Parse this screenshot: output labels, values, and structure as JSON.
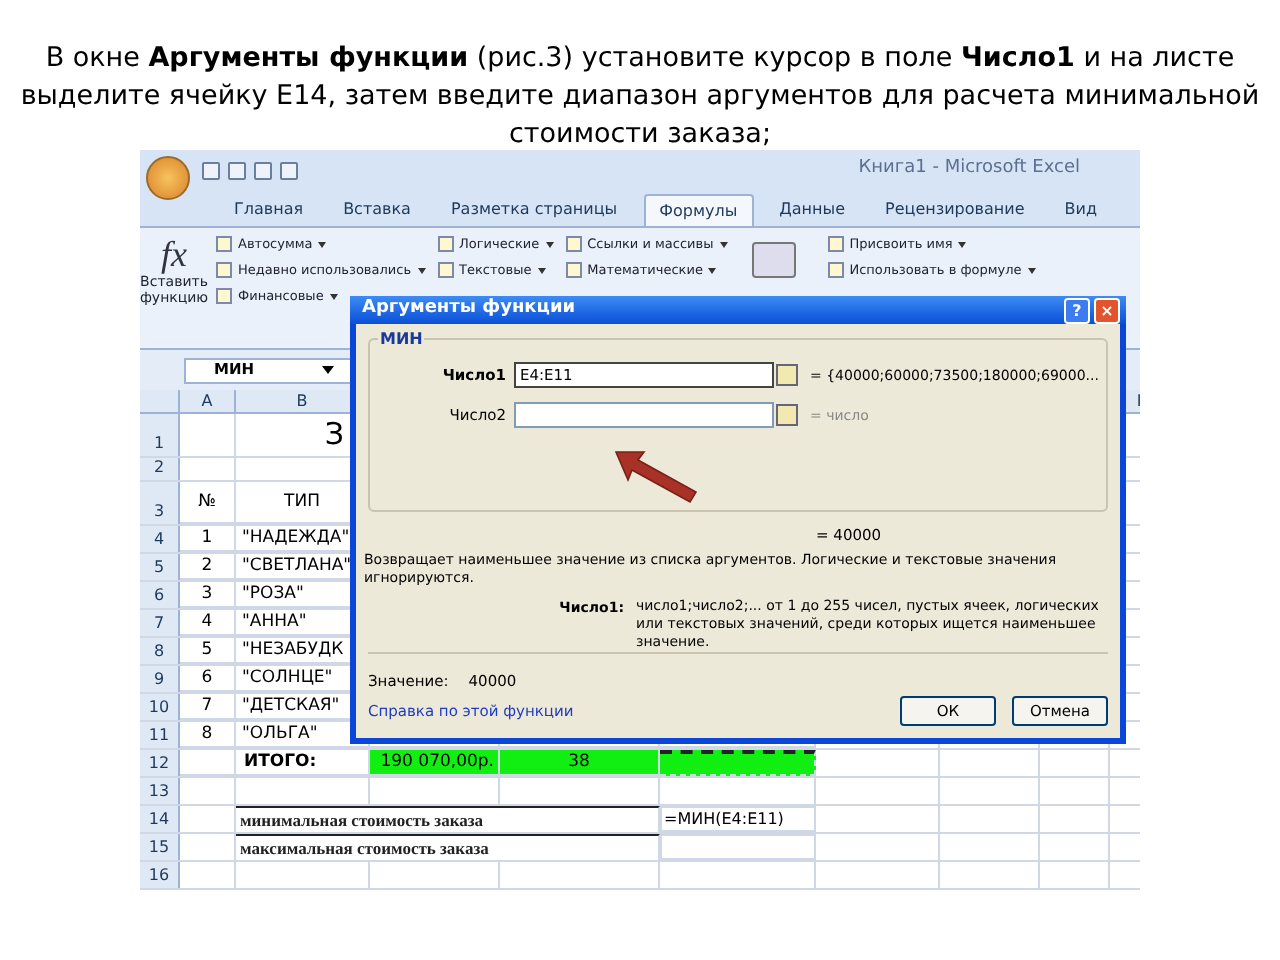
{
  "instruction": "В окне **Аргументы функции** (рис.3) установите курсор в поле **Число1** и на листе выделите ячейку E14, затем введите диапазон аргументов для расчета минимальной стоимости заказа;",
  "excel": {
    "title": "Книга1 - Microsoft Excel",
    "tabs": [
      {
        "label": "Главная",
        "selected": false
      },
      {
        "label": "Вставка",
        "selected": false
      },
      {
        "label": "Разметка страницы",
        "selected": false
      },
      {
        "label": "Формулы",
        "selected": true
      },
      {
        "label": "Данные",
        "selected": false
      },
      {
        "label": "Рецензирование",
        "selected": false
      },
      {
        "label": "Вид",
        "selected": false
      }
    ],
    "insert_function_icon": "fx",
    "insert_function": "Вставить функцию",
    "ribbon_columns": [
      [
        "Автосумма",
        "Недавно использовались",
        "Финансовые"
      ],
      [
        "Логические",
        "Текстовые"
      ],
      [
        "Ссылки и массивы",
        "Математические"
      ],
      [
        "Присвоить имя",
        "Использовать в формуле"
      ]
    ],
    "name_box": "МИН",
    "column_headers": [
      "A",
      "B",
      "I"
    ],
    "rows": [
      {
        "kind": "title",
        "header": "1",
        "text": "З"
      },
      {
        "kind": "blank",
        "header": "2"
      },
      {
        "kind": "head",
        "header": "3",
        "a": "№",
        "b": "ТИП"
      },
      {
        "kind": "item",
        "header": "4",
        "a": "1",
        "b": "\"НАДЕЖДА\""
      },
      {
        "kind": "item",
        "header": "5",
        "a": "2",
        "b": "\"СВЕТЛАНА\""
      },
      {
        "kind": "item",
        "header": "6",
        "a": "3",
        "b": "\"РОЗА\""
      },
      {
        "kind": "item",
        "header": "7",
        "a": "4",
        "b": "\"АННА\""
      },
      {
        "kind": "item",
        "header": "8",
        "a": "5",
        "b": "\"НЕЗАБУДК"
      },
      {
        "kind": "item",
        "header": "9",
        "a": "6",
        "b": "\"СОЛНЦЕ\""
      },
      {
        "kind": "item",
        "header": "10",
        "a": "7",
        "b": "\"ДЕТСКАЯ\""
      },
      {
        "kind": "item",
        "header": "11",
        "a": "8",
        "b": "\"ОЛЬГА\""
      },
      {
        "kind": "total",
        "header": "12",
        "b": "ИТОГО:",
        "c": "190 070,00р.",
        "d": "38"
      },
      {
        "kind": "blank",
        "header": "13"
      },
      {
        "kind": "summary",
        "header": "14",
        "b": "минимальная стоимость заказа",
        "e": "=МИН(E4:E11)"
      },
      {
        "kind": "summary",
        "header": "15",
        "b": "максимальная стоимость заказа"
      },
      {
        "kind": "blank",
        "header": "16"
      }
    ]
  },
  "dialog": {
    "title": "Аргументы функции",
    "title_buttons": [
      "?",
      "×"
    ],
    "function": "МИН",
    "args": [
      {
        "label": "Число1",
        "value": "E4:E11",
        "result": "= {40000;60000;73500;180000;69000...",
        "focused": true
      },
      {
        "label": "Число2",
        "result": "= число",
        "focused": false
      }
    ],
    "result": "= 40000",
    "description": "Возвращает наименьшее значение из списка аргументов. Логические и текстовые значения игнорируются.",
    "arg_label": "Число1:",
    "arg_help": "число1;число2;... от 1 до 255 чисел, пустых ячеек, логических или текстовых значений, среди которых ищется наименьшее значение.",
    "value_label": "Значение:",
    "value": "40000",
    "help_link": "Справка по этой функции",
    "buttons": [
      "ОК",
      "Отмена"
    ]
  }
}
